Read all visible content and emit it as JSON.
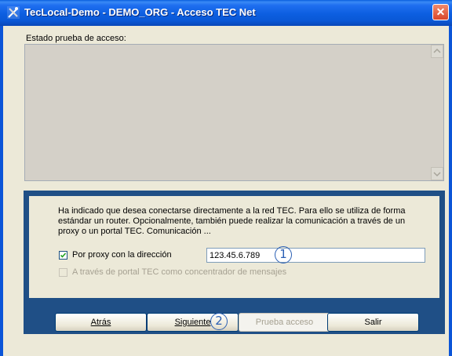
{
  "window": {
    "title": "TecLocal-Demo - DEMO_ORG - Acceso TEC Net",
    "close_symbol": "✕"
  },
  "status": {
    "label": "Estado prueba de acceso:",
    "content": ""
  },
  "info": {
    "text": "Ha indicado que desea conectarse directamente a la red TEC. Para ello se utiliza de forma estándar un router. Opcionalmente, también puede realizar la comunicación a través de un proxy o un portal TEC. Comunicación ..."
  },
  "proxy": {
    "checked": true,
    "label": "Por proxy con la dirección",
    "address": "123.45.6.789"
  },
  "portal": {
    "checked": false,
    "enabled": false,
    "label": "A través de portal TEC como concentrador de mensajes"
  },
  "callouts": {
    "one": "1",
    "two": "2"
  },
  "buttons": {
    "back": "Atrás",
    "next": "Siguiente",
    "test": "Prueba acceso",
    "exit": "Salir"
  },
  "colors": {
    "titlebar": "#0a58d6",
    "panel": "#1f4f86",
    "dialog_bg": "#ece9d8",
    "callout": "#2a5fb4"
  },
  "icons": {
    "app": "teclocal-app-icon",
    "close": "close-icon",
    "scroll_up": "scroll-up-arrow-icon",
    "scroll_down": "scroll-down-arrow-icon",
    "check": "checkmark-icon"
  }
}
